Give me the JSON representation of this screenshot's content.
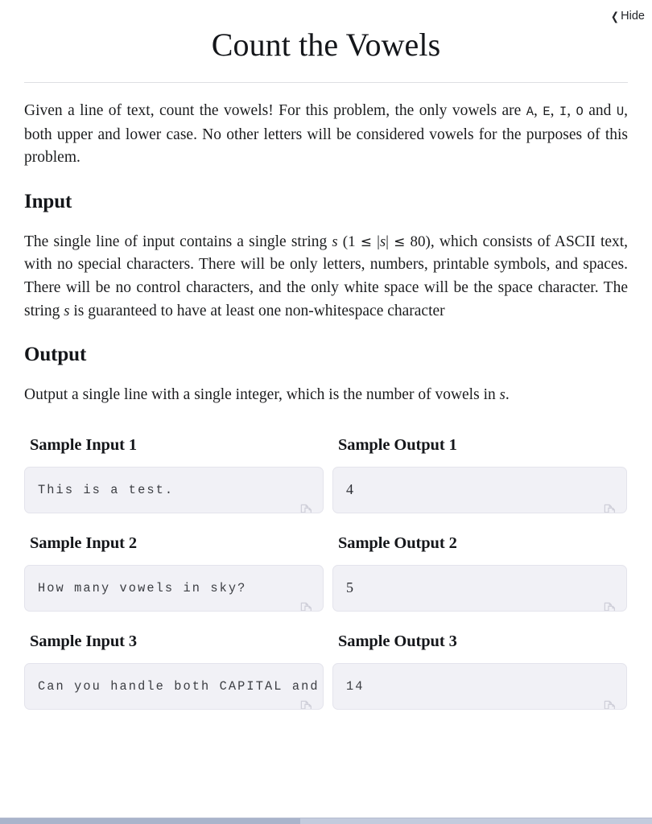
{
  "header": {
    "hide_label": "Hide",
    "hide_chevron": "chevron-left-icon",
    "title": "Count the Vowels"
  },
  "description": {
    "part1": "Given a line of text, count the vowels! For this problem, the only vowels are ",
    "vowel_a": "A",
    "sep1": ", ",
    "vowel_e": "E",
    "sep2": ", ",
    "vowel_i": "I",
    "sep3": ", ",
    "vowel_o": "O",
    "sep4": " and ",
    "vowel_u": "U",
    "part2": ", both upper and lower case. No other letters will be considered vowels for the purposes of this problem."
  },
  "input_section": {
    "heading": "Input",
    "text_before": "The single line of input contains a single string ",
    "var_s": "s",
    "paren_open": "(",
    "num_min": "1",
    "le1": "≤",
    "abs_open": "|",
    "abs_var": "s",
    "abs_close": "|",
    "le2": "≤",
    "num_max": "80",
    "paren_close": ")",
    "text_middle": ", which consists of ASCII text, with no special characters. There will be only letters, numbers, printable symbols, and spaces. There will be no control characters, and the only white space will be the space character. The string ",
    "var_s2": "s",
    "text_after": " is guaranteed to have at least one non-whitespace character"
  },
  "output_section": {
    "heading": "Output",
    "text_before": "Output a single line with a single integer, which is the number of vowels in ",
    "var_s": "s",
    "text_after": "."
  },
  "samples": [
    {
      "input_label": "Sample Input 1",
      "input_value": "This is a test.",
      "input_mono": true,
      "output_label": "Sample Output 1",
      "output_value": "4",
      "output_mono": false
    },
    {
      "input_label": "Sample Input 2",
      "input_value": "How many vowels in sky?",
      "input_mono": true,
      "output_label": "Sample Output 2",
      "output_value": "5",
      "output_mono": false
    },
    {
      "input_label": "Sample Input 3",
      "input_value": "Can you handle both CAPITAL and lowercase letters?",
      "input_mono": true,
      "output_label": "Sample Output 3",
      "output_value": "14",
      "output_mono": true
    }
  ],
  "icons": {
    "copy": "copy-icon"
  },
  "colors": {
    "page_background": "#ffffff",
    "sample_box_background": "#f1f1f6",
    "sample_box_border": "#e4e4ec",
    "text": "#1c1d1f",
    "divider": "#dedfe2",
    "scrollbar": "#c3cbdd"
  }
}
